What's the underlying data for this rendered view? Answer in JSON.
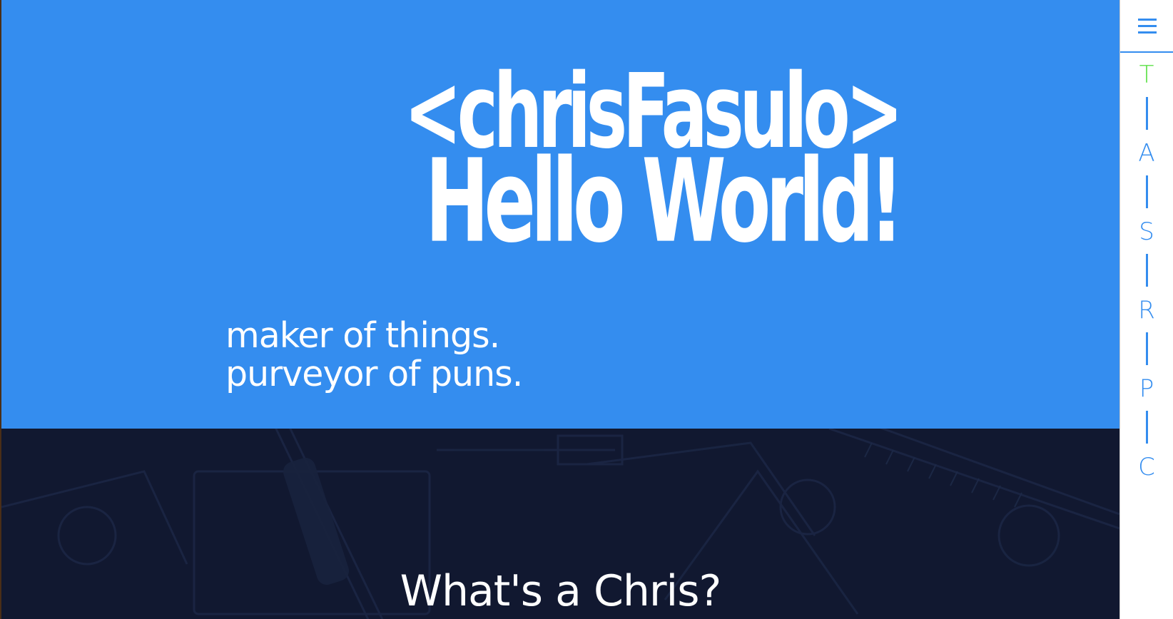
{
  "hero": {
    "brand_name": "<chrisFasulo>",
    "headline": "Hello World!",
    "tagline_line1": "maker of things.",
    "tagline_line2": "purveyor of puns."
  },
  "about": {
    "title": "What's a Chris?"
  },
  "sidenav": {
    "menu_icon": "hamburger-menu-icon",
    "items": [
      {
        "label": "T",
        "active": true
      },
      {
        "label": "A",
        "active": false
      },
      {
        "label": "S",
        "active": false
      },
      {
        "label": "R",
        "active": false
      },
      {
        "label": "P",
        "active": false
      },
      {
        "label": "C",
        "active": false
      }
    ]
  },
  "colors": {
    "hero_background": "#348def",
    "about_background": "#111830",
    "nav_accent": "#348def",
    "nav_active": "#5fe14a",
    "text_light": "#ffffff"
  }
}
